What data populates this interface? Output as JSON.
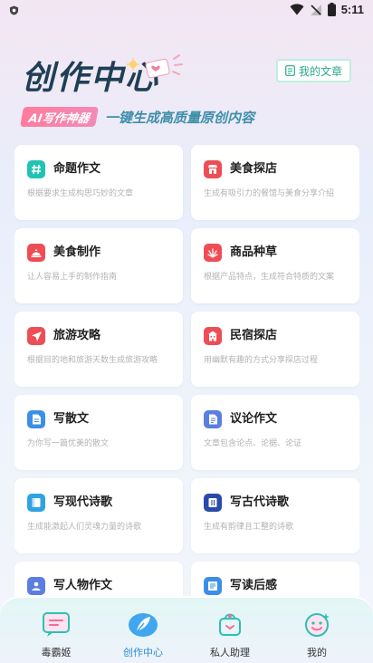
{
  "status": {
    "time": "5:11"
  },
  "header": {
    "title": "创作中心",
    "my_articles": "我的文章",
    "ai_badge": "AI写作神器",
    "tagline": "一键生成高质量原创内容"
  },
  "cards": [
    {
      "title": "命题作文",
      "desc": "根据要求生成构思巧妙的文章",
      "icon": "hash-icon",
      "color": "#22c3b4"
    },
    {
      "title": "美食探店",
      "desc": "生成有吸引力的餐馆与美食分享介绍",
      "icon": "store-icon",
      "color": "#ee4d55"
    },
    {
      "title": "美食制作",
      "desc": "让人容易上手的制作指南",
      "icon": "cloche-icon",
      "color": "#ee4d55"
    },
    {
      "title": "商品种草",
      "desc": "根据产品特点，生成符合特质的文案",
      "icon": "grass-icon",
      "color": "#ee4d55"
    },
    {
      "title": "旅游攻略",
      "desc": "根据目的地和旅游天数生成旅游攻略",
      "icon": "plane-icon",
      "color": "#ee4d55"
    },
    {
      "title": "民宿探店",
      "desc": "用幽默有趣的方式分享探店过程",
      "icon": "building-icon",
      "color": "#ee4d55"
    },
    {
      "title": "写散文",
      "desc": "为你写一篇优美的散文",
      "icon": "document-icon",
      "color": "#3b8fe6"
    },
    {
      "title": "议论作文",
      "desc": "文章包含论点、论据、论证",
      "icon": "document-icon",
      "color": "#5b7fe0"
    },
    {
      "title": "写现代诗歌",
      "desc": "生成能激起人们灵魂力量的诗歌",
      "icon": "book-icon",
      "color": "#2fa3e0"
    },
    {
      "title": "写古代诗歌",
      "desc": "生成有韵律且工整的诗歌",
      "icon": "book-icon",
      "color": "#2a4aa8"
    },
    {
      "title": "写人物作文",
      "desc": "",
      "icon": "person-icon",
      "color": "#5b7fe0"
    },
    {
      "title": "写读后感",
      "desc": "",
      "icon": "notes-icon",
      "color": "#3b8fe6"
    }
  ],
  "tabs": [
    {
      "label": "毒霸姬",
      "icon": "chat-icon"
    },
    {
      "label": "创作中心",
      "icon": "feather-icon"
    },
    {
      "label": "私人助理",
      "icon": "bag-icon"
    },
    {
      "label": "我的",
      "icon": "smile-icon"
    }
  ],
  "active_tab": 1
}
